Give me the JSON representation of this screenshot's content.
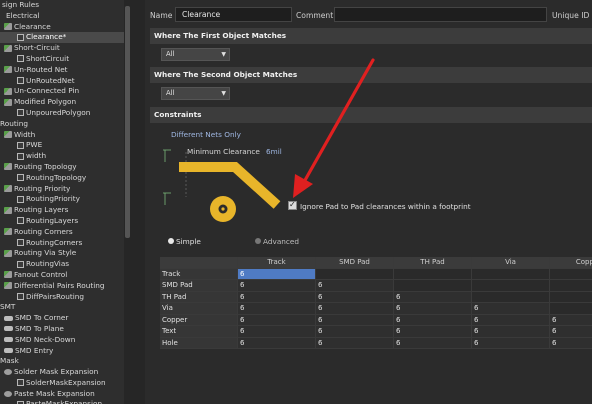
{
  "tree": {
    "items": [
      {
        "label": "sign Rules",
        "indent": 2,
        "icon": "cat"
      },
      {
        "label": "Electrical",
        "indent": 6,
        "icon": "cat"
      },
      {
        "label": "Clearance",
        "indent": 4,
        "icon": "rule"
      },
      {
        "label": "Clearance*",
        "indent": 17,
        "icon": "leaf",
        "selected": true
      },
      {
        "label": "Short-Circuit",
        "indent": 4,
        "icon": "rule"
      },
      {
        "label": "ShortCircuit",
        "indent": 17,
        "icon": "leaf"
      },
      {
        "label": "Un-Routed Net",
        "indent": 4,
        "icon": "rule"
      },
      {
        "label": "UnRoutedNet",
        "indent": 17,
        "icon": "leaf"
      },
      {
        "label": "Un-Connected Pin",
        "indent": 4,
        "icon": "rule"
      },
      {
        "label": "Modified Polygon",
        "indent": 4,
        "icon": "rule"
      },
      {
        "label": "UnpouredPolygon",
        "indent": 17,
        "icon": "leaf"
      },
      {
        "label": "Routing",
        "indent": 0,
        "icon": "cat"
      },
      {
        "label": "Width",
        "indent": 4,
        "icon": "rule"
      },
      {
        "label": "PWE",
        "indent": 17,
        "icon": "leaf"
      },
      {
        "label": "width",
        "indent": 17,
        "icon": "leaf"
      },
      {
        "label": "Routing Topology",
        "indent": 4,
        "icon": "rule"
      },
      {
        "label": "RoutingTopology",
        "indent": 17,
        "icon": "leaf"
      },
      {
        "label": "Routing Priority",
        "indent": 4,
        "icon": "rule"
      },
      {
        "label": "RoutingPriority",
        "indent": 17,
        "icon": "leaf"
      },
      {
        "label": "Routing Layers",
        "indent": 4,
        "icon": "rule"
      },
      {
        "label": "RoutingLayers",
        "indent": 17,
        "icon": "leaf"
      },
      {
        "label": "Routing Corners",
        "indent": 4,
        "icon": "rule"
      },
      {
        "label": "RoutingCorners",
        "indent": 17,
        "icon": "leaf"
      },
      {
        "label": "Routing Via Style",
        "indent": 4,
        "icon": "rule"
      },
      {
        "label": "RoutingVias",
        "indent": 17,
        "icon": "leaf"
      },
      {
        "label": "Fanout Control",
        "indent": 4,
        "icon": "rule"
      },
      {
        "label": "Differential Pairs Routing",
        "indent": 4,
        "icon": "rule"
      },
      {
        "label": "DiffPairsRouting",
        "indent": 17,
        "icon": "leaf"
      },
      {
        "label": "SMT",
        "indent": 0,
        "icon": "cat"
      },
      {
        "label": "SMD To Corner",
        "indent": 4,
        "icon": "smd"
      },
      {
        "label": "SMD To Plane",
        "indent": 4,
        "icon": "smd"
      },
      {
        "label": "SMD Neck-Down",
        "indent": 4,
        "icon": "smd"
      },
      {
        "label": "SMD Entry",
        "indent": 4,
        "icon": "smd"
      },
      {
        "label": "Mask",
        "indent": 0,
        "icon": "cat"
      },
      {
        "label": "Solder Mask Expansion",
        "indent": 4,
        "icon": "mask"
      },
      {
        "label": "SolderMaskExpansion",
        "indent": 17,
        "icon": "leaf"
      },
      {
        "label": "Paste Mask Expansion",
        "indent": 4,
        "icon": "mask"
      },
      {
        "label": "PasteMaskExpansion",
        "indent": 17,
        "icon": "leaf"
      }
    ]
  },
  "header": {
    "name_label": "Name",
    "name_value": "Clearance",
    "comment_label": "Comment",
    "comment_value": "",
    "uid_label": "Unique ID"
  },
  "first_match": {
    "title": "Where The First Object Matches",
    "value": "All"
  },
  "second_match": {
    "title": "Where The Second Object Matches",
    "value": "All"
  },
  "constraints": {
    "title": "Constraints",
    "nets": "Different Nets Only",
    "min_clearance_label": "Minimum Clearance",
    "min_clearance_value": "6mil",
    "ignore_pad_label": "Ignore Pad to Pad clearances within a footprint",
    "ignore_pad_checked": true,
    "mode_simple": "Simple",
    "mode_advanced": "Advanced",
    "mode_selected": "Simple"
  },
  "matrix": {
    "columns": [
      "Track",
      "SMD Pad",
      "TH Pad",
      "Via",
      "Copper"
    ],
    "rows": [
      {
        "label": "Track",
        "values": [
          "6",
          "",
          "",
          "",
          ""
        ]
      },
      {
        "label": "SMD Pad",
        "values": [
          "6",
          "6",
          "",
          "",
          ""
        ]
      },
      {
        "label": "TH Pad",
        "values": [
          "6",
          "6",
          "6",
          "",
          ""
        ]
      },
      {
        "label": "Via",
        "values": [
          "6",
          "6",
          "6",
          "6",
          ""
        ]
      },
      {
        "label": "Copper",
        "values": [
          "6",
          "6",
          "6",
          "6",
          "6"
        ]
      },
      {
        "label": "Text",
        "values": [
          "6",
          "6",
          "6",
          "6",
          "6"
        ]
      },
      {
        "label": "Hole",
        "values": [
          "6",
          "6",
          "6",
          "6",
          "6"
        ]
      }
    ]
  },
  "colors": {
    "accent_blue": "#4f7bc4",
    "diagram_yellow": "#e8b52a",
    "arrow_red": "#e02020"
  }
}
